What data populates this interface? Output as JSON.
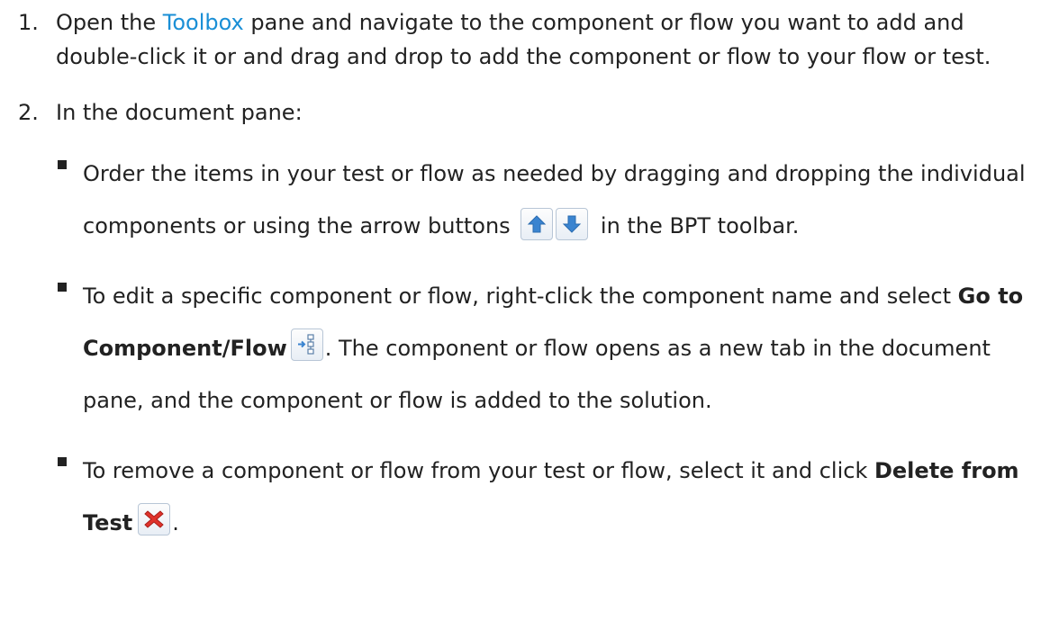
{
  "steps": [
    {
      "number": "1.",
      "text_before": "Open the ",
      "link": "Toolbox",
      "text_after": " pane and navigate to the component or flow you want to add and double-click it or and drag and drop to add the component or flow to your flow or test."
    },
    {
      "number": "2.",
      "intro": "In the document pane:",
      "bullets": [
        {
          "text_before": "Order the items in your test or flow as needed by dragging and dropping the individual components or using the arrow buttons",
          "text_after": " in the BPT toolbar.",
          "icons": [
            "arrow-up-icon",
            "arrow-down-icon"
          ]
        },
        {
          "text_before": "To edit a specific component or flow, right-click the component name and select ",
          "bold": "Go to Component/Flow",
          "text_after": ". The component or flow opens as a new tab in the document pane, and the component or flow is added to the solution.",
          "icon": "go-to-component-icon"
        },
        {
          "text_before": "To remove a component or flow from your test or flow, select it and click ",
          "bold": "Delete from Test",
          "text_after": ".",
          "icon": "delete-x-icon"
        }
      ]
    }
  ],
  "colors": {
    "link": "#1a8fd6",
    "text": "#222222",
    "arrow": "#3a84d0",
    "delete": "#e0332b"
  }
}
